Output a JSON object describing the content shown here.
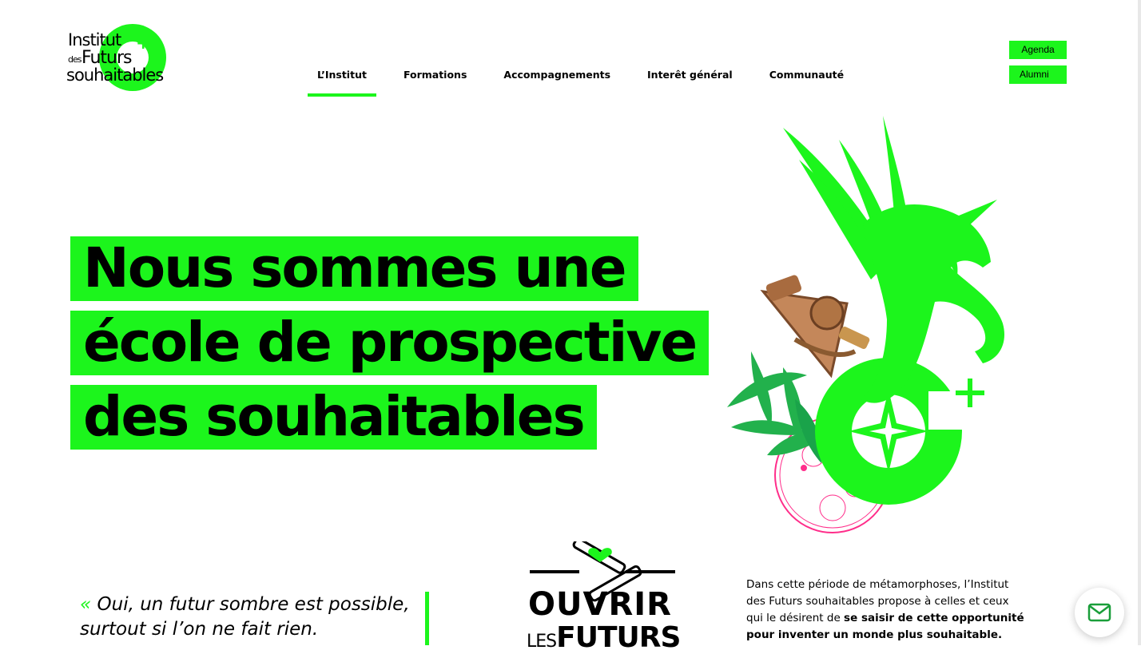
{
  "logo": {
    "line1": "Institut",
    "line2a": "des",
    "line2b": "Futurs",
    "line3": "souhaitables",
    "plus": "+"
  },
  "nav": [
    {
      "label": "L’Institut",
      "active": true
    },
    {
      "label": "Formations",
      "active": false
    },
    {
      "label": "Accompagnements",
      "active": false
    },
    {
      "label": "Interêt général",
      "active": false
    },
    {
      "label": "Communauté",
      "active": false
    }
  ],
  "buttons": {
    "agenda": "Agenda",
    "alumni": "Alumni"
  },
  "hero": {
    "line1": "Nous sommes une",
    "line2": "école de prospective",
    "line3": "des souhaitables"
  },
  "quote": {
    "mark": "«",
    "line1": "Oui, un futur sombre est possible,",
    "line2": "surtout si l’on ne fait rien."
  },
  "badge": {
    "line1": "OUVRIR",
    "line2a": "LES",
    "line2b": "FUTURS"
  },
  "intro": {
    "text1": "Dans cette période de métamorphoses, l’Institut des Futurs souhaitables propose à celles et ceux qui le désirent de ",
    "text_bold": "se saisir de cette opportunité pour inventer un monde plus souhaitable."
  },
  "colors": {
    "accent": "#1cf51c",
    "pink": "#ff2d8a",
    "text": "#000000",
    "background": "#ffffff"
  },
  "icons": [
    "mail-icon",
    "pegasus-illustration",
    "sextant-illustration",
    "compass-star-icon",
    "telescopes-icon",
    "heart-icon"
  ]
}
